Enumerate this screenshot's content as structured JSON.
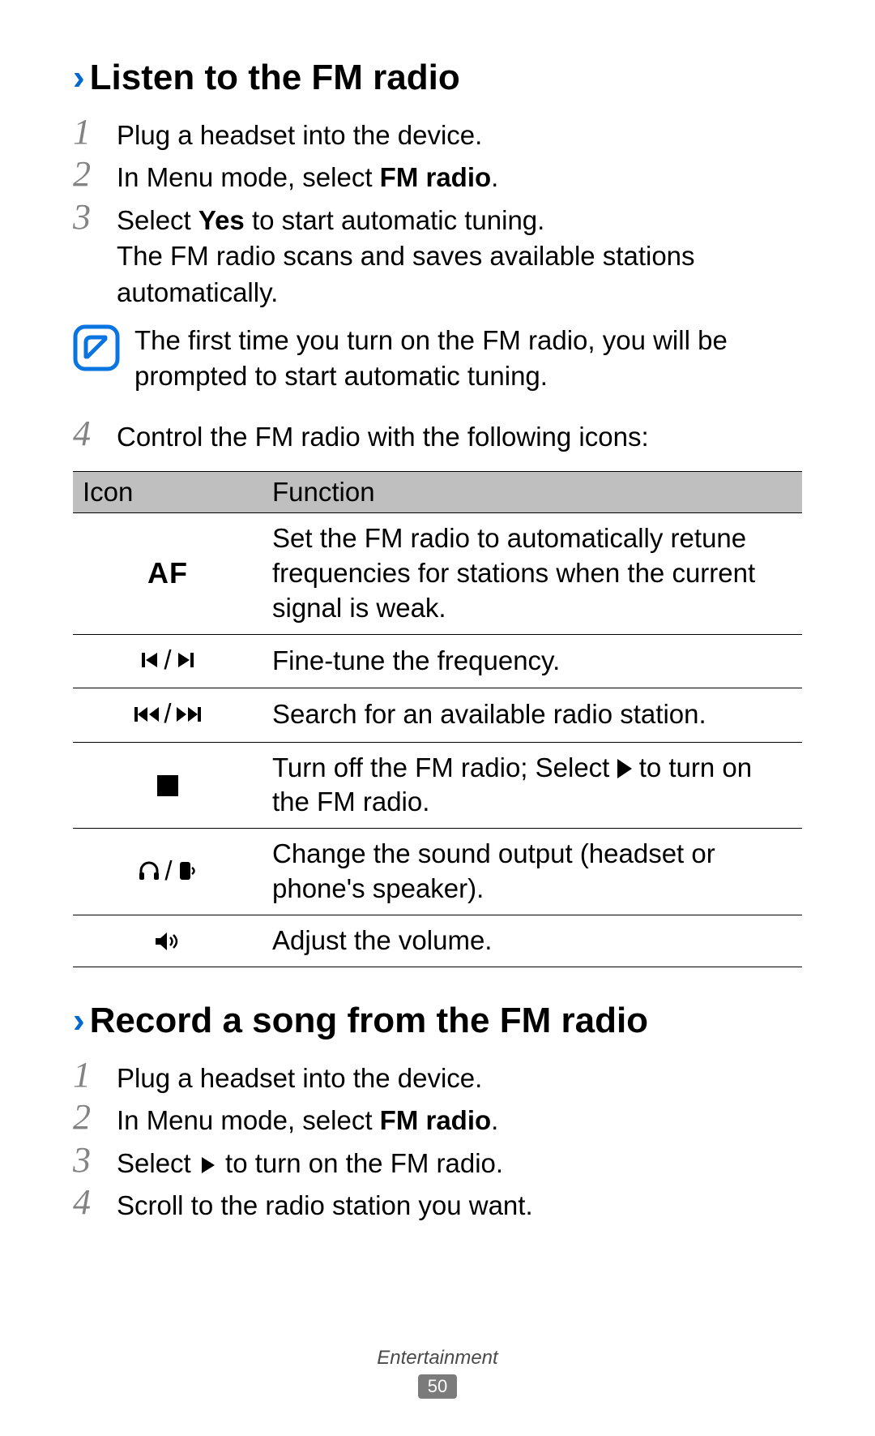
{
  "section1": {
    "title": "Listen to the FM radio",
    "steps": [
      {
        "n": "1",
        "html": "Plug a headset into the device."
      },
      {
        "n": "2",
        "html": "In Menu mode, select <b>FM radio</b>."
      },
      {
        "n": "3",
        "html": "Select <b>Yes</b> to start automatic tuning.\nThe FM radio scans and saves available stations automatically."
      },
      {
        "n": "4",
        "html": "Control the FM radio with the following icons:"
      }
    ],
    "note": "The first time you turn on the FM radio, you will be prompted to start automatic tuning."
  },
  "table": {
    "headers": [
      "Icon",
      "Function"
    ],
    "rows": [
      {
        "icon": "af",
        "fn": "Set the FM radio to automatically retune frequencies for stations when the current signal is weak."
      },
      {
        "icon": "fine",
        "fn": "Fine-tune the frequency."
      },
      {
        "icon": "search",
        "fn": "Search for an available radio station."
      },
      {
        "icon": "stop",
        "fn_html": "Turn off the FM radio; Select <play> to turn on the FM radio."
      },
      {
        "icon": "output",
        "fn": "Change the sound output (headset or phone's speaker)."
      },
      {
        "icon": "volume",
        "fn": "Adjust the volume."
      }
    ]
  },
  "icon_names": {
    "af": "AF",
    "fine": "prev-track / next-track",
    "search": "rewind / fast-forward",
    "stop": "stop",
    "play": "play",
    "output": "headphones / phone-speaker",
    "volume": "speaker-volume"
  },
  "section2": {
    "title": "Record a song from the FM radio",
    "steps": [
      {
        "n": "1",
        "html": "Plug a headset into the device."
      },
      {
        "n": "2",
        "html": "In Menu mode, select <b>FM radio</b>."
      },
      {
        "n": "3",
        "html": "Select <play> to turn on the FM radio."
      },
      {
        "n": "4",
        "html": "Scroll to the radio station you want."
      }
    ]
  },
  "footer": {
    "category": "Entertainment",
    "page": "50"
  }
}
